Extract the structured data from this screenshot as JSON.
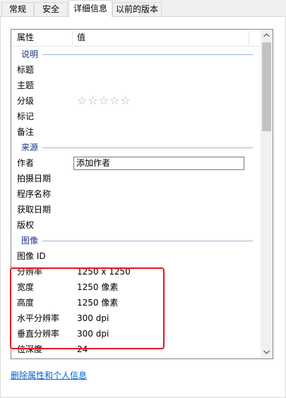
{
  "tabs": [
    {
      "label": "常规",
      "active": false
    },
    {
      "label": "安全",
      "active": false
    },
    {
      "label": "详细信息",
      "active": true
    },
    {
      "label": "以前的版本",
      "active": false
    }
  ],
  "columns": {
    "property": "属性",
    "value": "值"
  },
  "groups": {
    "description": "说明",
    "origin": "来源",
    "image": "图像"
  },
  "description_rows": [
    {
      "key": "标题",
      "value": ""
    },
    {
      "key": "主题",
      "value": ""
    },
    {
      "key": "分级",
      "value": "☆☆☆☆☆"
    },
    {
      "key": "标记",
      "value": ""
    },
    {
      "key": "备注",
      "value": ""
    }
  ],
  "origin_rows": [
    {
      "key": "作者",
      "value": "添加作者"
    },
    {
      "key": "拍摄日期",
      "value": ""
    },
    {
      "key": "程序名称",
      "value": ""
    },
    {
      "key": "获取日期",
      "value": ""
    },
    {
      "key": "版权",
      "value": ""
    }
  ],
  "image_rows": [
    {
      "key": "图像 ID",
      "value": ""
    },
    {
      "key": "分辨率",
      "value": "1250 x 1250"
    },
    {
      "key": "宽度",
      "value": "1250 像素"
    },
    {
      "key": "高度",
      "value": "1250 像素"
    },
    {
      "key": "水平分辨率",
      "value": "300 dpi"
    },
    {
      "key": "垂直分辨率",
      "value": "300 dpi"
    },
    {
      "key": "位深度",
      "value": "24"
    }
  ],
  "rating_stars": 0,
  "remove_link": "删除属性和个人信息",
  "icons": {
    "scroll_up": "chevron-up-icon",
    "scroll_down": "chevron-down-icon"
  },
  "colors": {
    "highlight": "#e8141e",
    "group_label": "#1e3287",
    "link": "#0066cc"
  }
}
